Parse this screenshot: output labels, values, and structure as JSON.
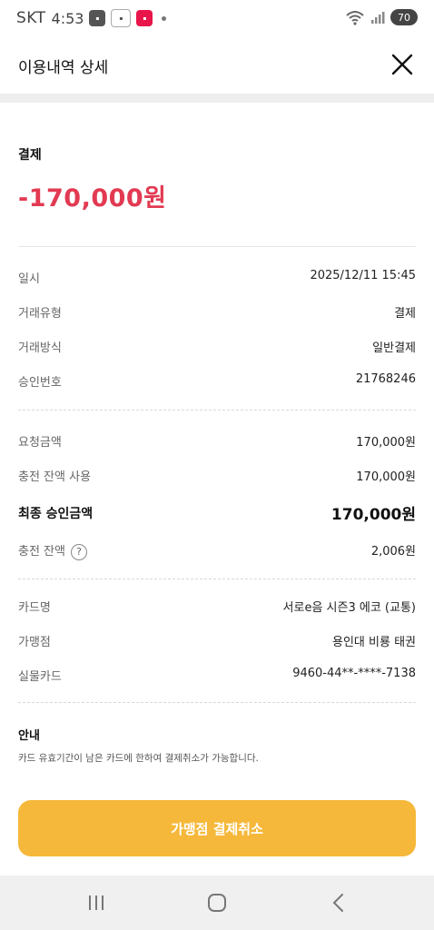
{
  "status_bar": {
    "carrier": "SKT",
    "time": "4:53",
    "app_icons": [
      "toss",
      "cashfeed",
      "coupang"
    ],
    "battery": "70"
  },
  "header": {
    "title": "이용내역 상세",
    "close_icon": "close-icon"
  },
  "payment": {
    "label": "결제",
    "amount": "-170,000원",
    "amount_color": "#e23a52"
  },
  "details_1": [
    {
      "label": "일시",
      "value": "2025/12/11 15:45"
    },
    {
      "label": "거래유형",
      "value": "결제"
    },
    {
      "label": "거래방식",
      "value": "일반결제"
    },
    {
      "label": "승인번호",
      "value": "21768246"
    }
  ],
  "details_2": {
    "request_amount": {
      "label": "요청금액",
      "value": "170,000원"
    },
    "charge_used": {
      "label": "충전 잔액 사용",
      "value": "170,000원"
    },
    "final_amount": {
      "label": "최종 승인금액",
      "value": "170,000원"
    },
    "charge_balance": {
      "label": "충전 잔액",
      "value": "2,006원"
    }
  },
  "details_3": [
    {
      "label": "카드명",
      "value": "서로e음 시즌3 에코 (교통)"
    },
    {
      "label": "가맹점",
      "value": "용인대 비룡 태권"
    },
    {
      "label": "실물카드",
      "value": "9460-44**-****-7138"
    }
  ],
  "notice": {
    "title": "안내",
    "text": "카드 유효기간이 남은 카드에 한하여 결제취소가 가능합니다."
  },
  "cancel_button": {
    "label": "가맹점 결제취소",
    "color": "#f6b83a"
  },
  "nav": {
    "recent": "recent-apps-icon",
    "home": "home-icon",
    "back": "back-icon"
  }
}
